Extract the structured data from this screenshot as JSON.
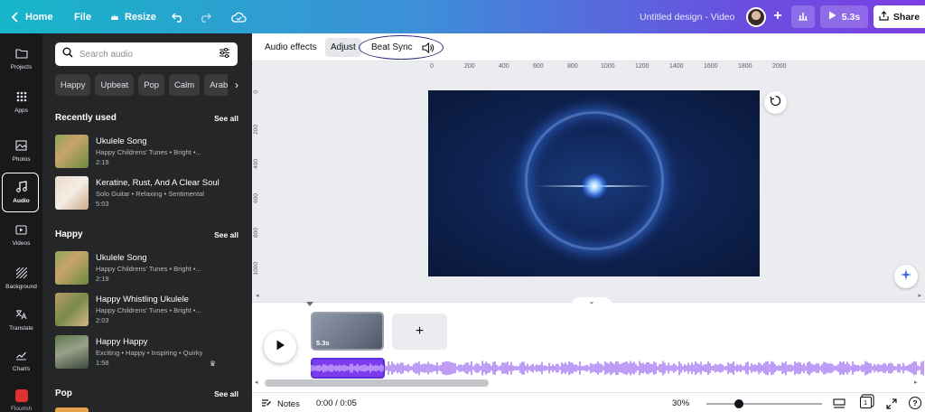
{
  "topbar": {
    "home": "Home",
    "file": "File",
    "resize": "Resize",
    "title": "Untitled design - Video",
    "play_duration": "5.3s",
    "share": "Share"
  },
  "rail": {
    "items": [
      {
        "label": "Projects",
        "icon": "folder-icon"
      },
      {
        "label": "Apps",
        "icon": "apps-grid-icon"
      },
      {
        "label": "Photos",
        "icon": "image-icon"
      },
      {
        "label": "Audio",
        "icon": "music-note-icon"
      },
      {
        "label": "Videos",
        "icon": "video-icon"
      },
      {
        "label": "Background",
        "icon": "background-pattern-icon"
      },
      {
        "label": "Translate",
        "icon": "translate-icon"
      },
      {
        "label": "Charts",
        "icon": "line-chart-icon"
      },
      {
        "label": "Flourish",
        "icon": "flourish-app-icon"
      }
    ],
    "active": "Audio"
  },
  "audio_panel": {
    "search_placeholder": "Search audio",
    "chips": [
      "Happy",
      "Upbeat",
      "Pop",
      "Calm",
      "Arabic"
    ],
    "see_all": "See all",
    "sections": [
      {
        "title": "Recently used",
        "tracks": [
          {
            "title": "Ukulele Song",
            "subtitle": "Happy Childrens' Tunes • Bright •...",
            "duration": "2:19"
          },
          {
            "title": "Keratine, Rust, And A Clear Soul",
            "subtitle": "Solo Guitar • Relaxing • Sentimental",
            "duration": "5:03"
          }
        ]
      },
      {
        "title": "Happy",
        "tracks": [
          {
            "title": "Ukulele Song",
            "subtitle": "Happy Childrens' Tunes • Bright •...",
            "duration": "2:19"
          },
          {
            "title": "Happy Whistling Ukulele",
            "subtitle": "Happy Childrens' Tunes • Bright •...",
            "duration": "2:03"
          },
          {
            "title": "Happy Happy",
            "subtitle": "Exciting • Happy • Inspiring • Quirky",
            "duration": "1:58"
          }
        ]
      },
      {
        "title": "Pop",
        "tracks": []
      }
    ]
  },
  "context_toolbar": {
    "audio_effects": "Audio effects",
    "adjust": "Adjust",
    "beat_sync": "Beat Sync"
  },
  "ruler": {
    "top": [
      "0",
      "200",
      "400",
      "600",
      "800",
      "1000",
      "1200",
      "1400",
      "1600",
      "1800",
      "2000"
    ],
    "left": [
      "0",
      "200",
      "400",
      "600",
      "800",
      "1000"
    ]
  },
  "timeline": {
    "clip_duration": "5.3s",
    "add_label": "+"
  },
  "statusbar": {
    "notes": "Notes",
    "time": "0:00 / 0:05",
    "zoom": "30%",
    "page_count": "1",
    "help": "?"
  },
  "colors": {
    "accent_purple": "#7d3bef",
    "panel_dark": "#252627",
    "rail_dark": "#18191b"
  }
}
